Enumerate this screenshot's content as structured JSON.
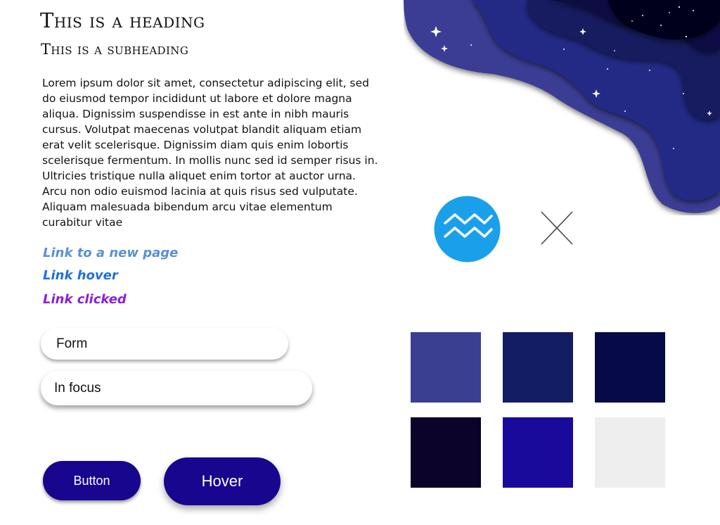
{
  "text": {
    "heading": "This is a heading",
    "subheading": "This is a subheading",
    "body": "Lorem ipsum dolor sit amet, consectetur adipiscing elit, sed do eiusmod tempor incididunt ut labore et dolore magna aliqua. Dignissim suspendisse in est ante in nibh mauris cursus. Volutpat maecenas volutpat blandit aliquam etiam erat velit scelerisque. Dignissim diam quis enim lobortis scelerisque fermentum. In mollis nunc sed id semper risus in. Ultricies tristique nulla aliquet enim tortor at auctor urna. Arcu non odio euismod lacinia at quis risus sed vulputate. Aliquam malesuada bibendum arcu vitae elementum curabitur vitae"
  },
  "links": {
    "new_page": "Link to a new page",
    "hover": "Link hover",
    "clicked": "Link clicked"
  },
  "form": {
    "field_label": "Form",
    "focus_label": "In focus"
  },
  "buttons": {
    "normal": "Button",
    "hover": "Hover"
  },
  "icons": [
    "aquarius-icon",
    "close-icon",
    "star-icon"
  ],
  "colors": {
    "link": "#5b8fd6",
    "link_hover": "#1f6fe0",
    "link_clicked": "#8a1fd9",
    "button": "#18068f",
    "icon_circle": "#1aa0ea"
  },
  "palette": [
    "#3b3f91",
    "#131d63",
    "#060b47",
    "#0c032a",
    "#190a9c",
    "#eeeeee"
  ]
}
